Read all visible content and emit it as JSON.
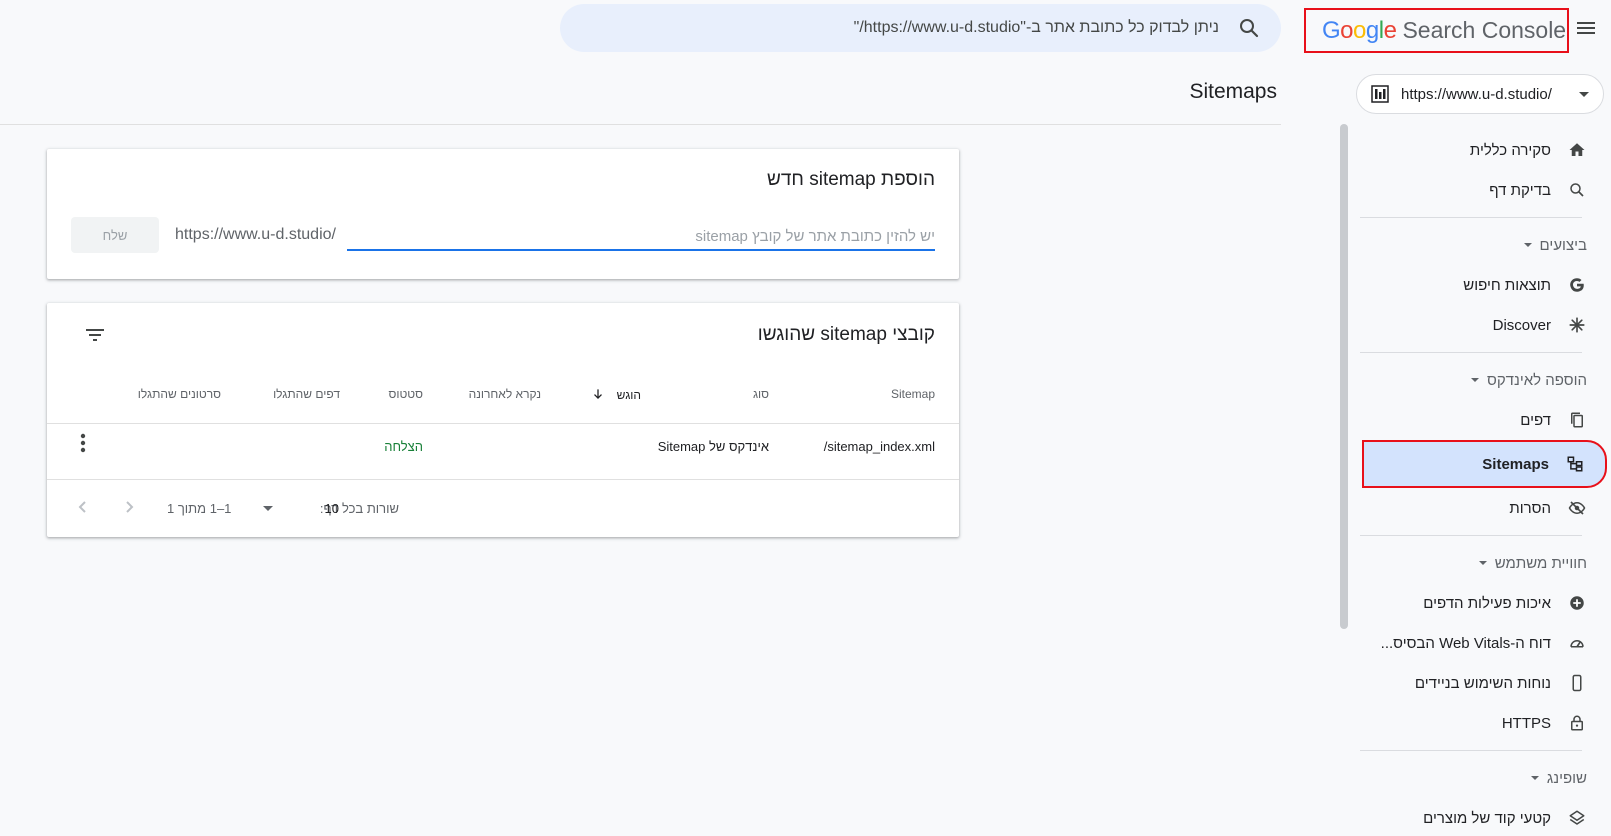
{
  "header": {
    "search_placeholder": "ניתן לבדוק כל כתובת אתר ב-\"https://www.u-d.studio/\"",
    "logo_letters": [
      "G",
      "o",
      "o",
      "g",
      "l",
      "e"
    ],
    "product_name": "Search Console"
  },
  "property": {
    "url": "https://www.u-d.studio/"
  },
  "page": {
    "title": "Sitemaps"
  },
  "sidebar": {
    "overview": "סקירה כללית",
    "inspect": "בדיקת דף",
    "sec_performance": "ביצועים",
    "search_results": "תוצאות חיפוש",
    "discover": "Discover",
    "sec_indexing": "הוספה לאינדקס",
    "pages": "דפים",
    "sitemaps": "Sitemaps",
    "removals": "הסרות",
    "sec_experience": "חוויית משתמש",
    "page_experience": "איכות פעילות הדפים",
    "web_vitals": "דוח ה-Web Vitals הבסיס...",
    "mobile": "נוחות השימוש בניידים",
    "https": "HTTPS",
    "sec_shopping": "שופינג",
    "product_snippets": "קטעי קוד של מוצרים"
  },
  "add_card": {
    "title": "הוספת sitemap חדש",
    "url_prefix": "https://www.u-d.studio/",
    "input_placeholder": "יש להזין כתובת אתר של קובץ sitemap",
    "submit_label": "שלח"
  },
  "submitted_card": {
    "title": "קובצי sitemap שהוגשו",
    "columns": {
      "sitemap": "Sitemap",
      "type": "סוג",
      "submitted": "הוגש",
      "last_read": "נקרא לאחרונה",
      "status": "סטטוס",
      "discovered_pages": "דפים שהתגלו",
      "discovered_videos": "סרטונים שהתגלו"
    },
    "rows": [
      {
        "sitemap": "/sitemap_index.xml",
        "type": "אינדקס של Sitemap",
        "status": "הצלחה"
      }
    ],
    "pager": {
      "rows_per_page_label": "שורות בכל דף:",
      "rows_per_page_value": "10",
      "range": "1–1 מתוך 1"
    }
  },
  "colors": {
    "accent": "#1a73e8",
    "active_bg": "#d3e3fd",
    "highlight_border": "#e8101a",
    "success": "#188038"
  }
}
